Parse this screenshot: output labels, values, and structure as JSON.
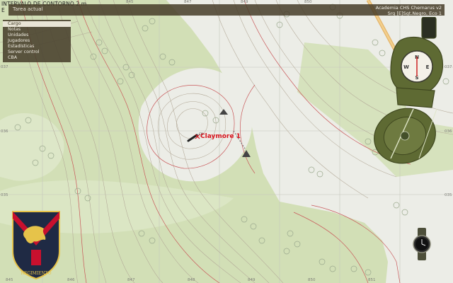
{
  "window": {
    "title_line1": "INTERVALO DE CONTORNO 2 m",
    "title_line2": "E"
  },
  "header": {
    "task_label": "Tarea actual",
    "mission_title": "Academia CHS Chernarus v2",
    "player_name": "Srg [E]Sgt.Negro, Eco 1"
  },
  "menu": {
    "items": [
      {
        "label": "Cargo",
        "selected": true
      },
      {
        "label": "Notas",
        "selected": false
      },
      {
        "label": "Unidades",
        "selected": false
      },
      {
        "label": "Jugadores",
        "selected": false
      },
      {
        "label": "Estadísticas",
        "selected": false
      },
      {
        "label": "Server control",
        "selected": false
      },
      {
        "label": "CBA",
        "selected": false
      }
    ]
  },
  "map": {
    "marker_label": "Claymore 1",
    "marker_abbr": "CM",
    "grid_labels_top": [
      "845",
      "847",
      "848",
      "849",
      "850",
      "851"
    ],
    "grid_labels_bottom": [
      "845",
      "846",
      "847",
      "848",
      "849",
      "850",
      "851"
    ],
    "grid_labels_left": [
      "037",
      "036",
      "035"
    ],
    "grid_labels_right": [
      "037",
      "036",
      "035"
    ]
  },
  "emblem": {
    "text": "REGIMIENTO"
  },
  "icons": {
    "compass": "compass-icon",
    "watch": "watch-icon",
    "emblem": "regiment-emblem-icon",
    "mine": "claymore-mine-icon"
  },
  "colors": {
    "forest": "#d2dfb6",
    "field": "#ecede7",
    "contour_major": "#c9585a",
    "contour_minor": "#b2a897",
    "marker": "#d8121c",
    "panel": "#48402c"
  }
}
